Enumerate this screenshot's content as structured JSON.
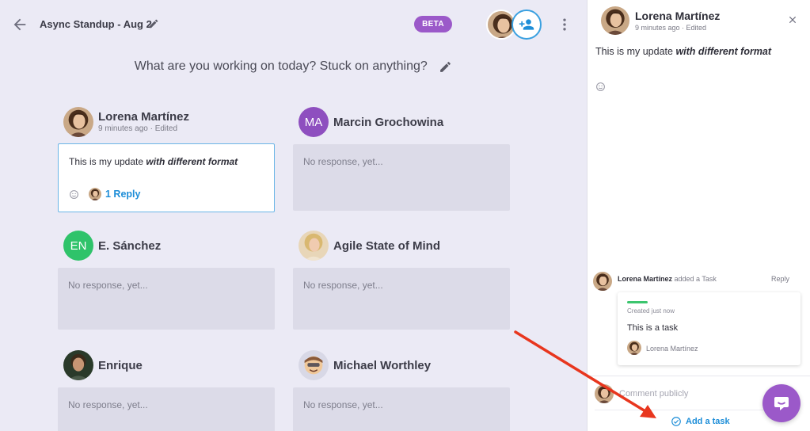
{
  "header": {
    "title": "Async Standup - Aug 2",
    "badge": "BETA"
  },
  "question": "What are you working on today? Stuck on anything?",
  "members": [
    {
      "name": "Lorena Martínez",
      "meta": "9 minutes ago · Edited",
      "response_plain": "This is my update ",
      "response_em": "with different format",
      "reply_label": "1 Reply"
    },
    {
      "name": "Marcin Grochowina",
      "initials": "MA",
      "avatar_color": "#8e4fbf",
      "response": "No response, yet..."
    },
    {
      "name": "E. Sánchez",
      "initials": "EN",
      "avatar_color": "#2fc36a",
      "response": "No response, yet..."
    },
    {
      "name": "Agile State of Mind",
      "response": "No response, yet..."
    },
    {
      "name": "Enrique",
      "response": "No response, yet..."
    },
    {
      "name": "Michael Worthley",
      "response": "No response, yet..."
    }
  ],
  "panel": {
    "author": "Lorena Martínez",
    "meta": "9 minutes ago · Edited",
    "text_plain": "This is my update ",
    "text_em": "with different format",
    "activity_author": "Lorena Martínez",
    "activity_action": " added a Task",
    "activity_reply": "Reply",
    "task": {
      "created": "Created just now",
      "title": "This is a task",
      "assignee": "Lorena Martínez",
      "status_color": "#3cc56e"
    },
    "comment_placeholder": "Comment publicly",
    "add_task_label": "Add a task"
  },
  "colors": {
    "accent": "#1e8ed8",
    "purple": "#9b59c9",
    "arrow": "#e8361e"
  }
}
